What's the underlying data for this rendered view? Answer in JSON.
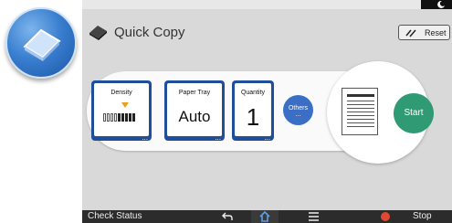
{
  "app": {
    "title": "Quick Copy",
    "icon": "copier-app-icon"
  },
  "header": {
    "reset_label": "Reset"
  },
  "tiles": {
    "density": {
      "label": "Density",
      "level": 2,
      "max_level": 9
    },
    "paper_tray": {
      "label": "Paper Tray",
      "value": "Auto"
    },
    "quantity": {
      "label": "Quantity",
      "value": "1"
    },
    "more_marker": "...",
    "others": {
      "label": "Others",
      "dots": "..."
    }
  },
  "start": {
    "label": "Start"
  },
  "bottombar": {
    "check_status": "Check Status",
    "stop": "Stop"
  },
  "colors": {
    "tile_border": "#1f4e9a",
    "start_green": "#2f9a73",
    "others_blue": "#3b6fc6",
    "bar_dark": "#2c2c2c",
    "stop_red": "#e04830"
  }
}
